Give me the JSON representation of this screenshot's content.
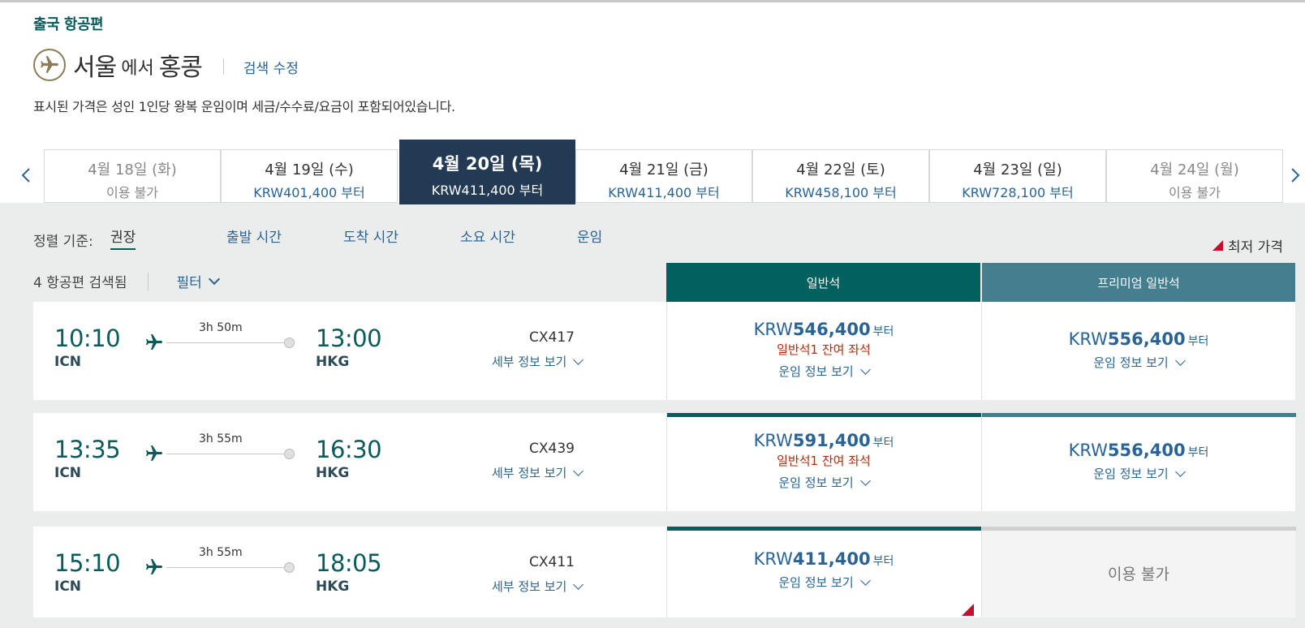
{
  "header": {
    "section_title": "출국 항공편",
    "origin": "서울",
    "connector": "에서",
    "destination": "홍콩",
    "edit_search": "검색 수정",
    "price_note": "표시된 가격은 성인 1인당 왕복 운임이며 세금/수수료/요금이 포함되어있습니다."
  },
  "dates": [
    {
      "date": "4월 18일 (화)",
      "price": "이용 불가",
      "available": false
    },
    {
      "date": "4월 19일 (수)",
      "price": "KRW401,400 부터",
      "available": true
    },
    {
      "date": "4월 20일 (목)",
      "price": "KRW411,400 부터",
      "available": true,
      "selected": true
    },
    {
      "date": "4월 21일 (금)",
      "price": "KRW411,400 부터",
      "available": true
    },
    {
      "date": "4월 22일 (토)",
      "price": "KRW458,100 부터",
      "available": true
    },
    {
      "date": "4월 23일 (일)",
      "price": "KRW728,100 부터",
      "available": true
    },
    {
      "date": "4월 24일 (월)",
      "price": "이용 불가",
      "available": false
    }
  ],
  "sort": {
    "label": "정렬 기준:",
    "options": [
      "권장",
      "출발 시간",
      "도착 시간",
      "소요 시간",
      "운임"
    ],
    "active": "권장"
  },
  "legend": {
    "lowest_fare": "최저 가격",
    "lowest_color": "#c8102e"
  },
  "results": {
    "count_text": "4 항공편 검색됨",
    "filter": "필터"
  },
  "cabins": {
    "economy": "일반석",
    "premium": "프리미엄 일반석"
  },
  "colors": {
    "teal": "#02605f",
    "premium": "#457e8f",
    "navy": "#233a55",
    "link": "#2a6496"
  },
  "flights": [
    {
      "dep_time": "10:10",
      "dep_airport": "ICN",
      "duration": "3h 50m",
      "arr_time": "13:00",
      "arr_airport": "HKG",
      "flight_no": "CX417",
      "details": "세부 정보 보기",
      "economy": {
        "currency": "KRW",
        "amount": "546,400",
        "suffix": "부터",
        "seats": "일반석1 잔여 좌석",
        "info": "운임 정보 보기"
      },
      "premium": {
        "currency": "KRW",
        "amount": "556,400",
        "suffix": "부터",
        "info": "운임 정보 보기"
      }
    },
    {
      "dep_time": "13:35",
      "dep_airport": "ICN",
      "duration": "3h 55m",
      "arr_time": "16:30",
      "arr_airport": "HKG",
      "flight_no": "CX439",
      "details": "세부 정보 보기",
      "economy": {
        "currency": "KRW",
        "amount": "591,400",
        "suffix": "부터",
        "seats": "일반석1 잔여 좌석",
        "info": "운임 정보 보기"
      },
      "premium": {
        "currency": "KRW",
        "amount": "556,400",
        "suffix": "부터",
        "info": "운임 정보 보기"
      }
    },
    {
      "dep_time": "15:10",
      "dep_airport": "ICN",
      "duration": "3h 55m",
      "arr_time": "18:05",
      "arr_airport": "HKG",
      "flight_no": "CX411",
      "details": "세부 정보 보기",
      "economy": {
        "currency": "KRW",
        "amount": "411,400",
        "suffix": "부터",
        "info": "운임 정보 보기",
        "lowest": true
      },
      "premium": {
        "unavailable": "이용 불가"
      }
    }
  ]
}
